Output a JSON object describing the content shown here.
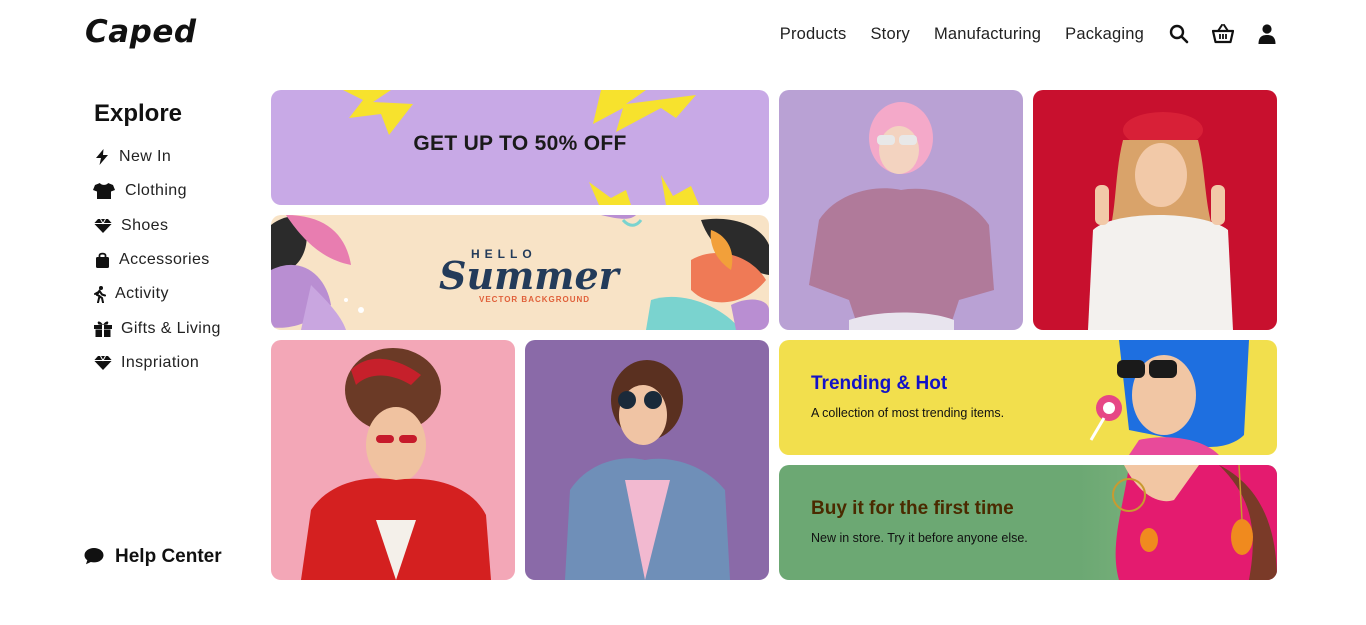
{
  "header": {
    "logo": "Caped",
    "nav": [
      "Products",
      "Story",
      "Manufacturing",
      "Packaging"
    ],
    "icons": [
      "search-icon",
      "basket-icon",
      "user-icon"
    ]
  },
  "sidebar": {
    "title": "Explore",
    "items": [
      {
        "label": "New In",
        "icon": "lightning-icon"
      },
      {
        "label": "Clothing",
        "icon": "tshirt-icon"
      },
      {
        "label": "Shoes",
        "icon": "gem-icon"
      },
      {
        "label": "Accessories",
        "icon": "bag-icon"
      },
      {
        "label": "Activity",
        "icon": "walking-icon"
      },
      {
        "label": "Gifts & Living",
        "icon": "gift-icon"
      },
      {
        "label": "Inspriation",
        "icon": "gem-icon"
      }
    ],
    "help": {
      "label": "Help Center",
      "icon": "chat-icon"
    }
  },
  "tiles": {
    "sale": {
      "text": "GET UP TO 50% OFF"
    },
    "summer": {
      "hello": "HELLO",
      "main": "Summer",
      "sub": "VECTOR BACKGROUND"
    },
    "trending": {
      "title": "Trending & Hot",
      "subtitle": "A collection of most trending items."
    },
    "buy": {
      "title": "Buy it for the first time",
      "subtitle": "New in store. Try it before anyone else."
    }
  },
  "colors": {
    "sale_bg": "#c8a9e6",
    "summer_bg": "#f8e3c6",
    "trending_bg": "#f2df4d",
    "trending_title": "#1212c8",
    "buy_bg": "#6ca873",
    "buy_title": "#4a2a00"
  }
}
